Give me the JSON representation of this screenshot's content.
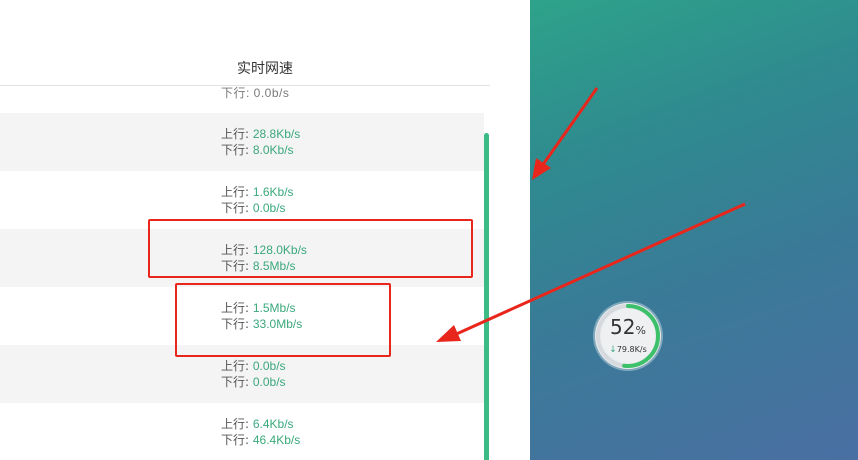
{
  "panel": {
    "column_header": "实时网速",
    "partial_row": {
      "down_value": "0.0b/s"
    },
    "rows": [
      {
        "up_label": "上行: ",
        "up_value": "28.8Kb/s",
        "down_label": "下行: ",
        "down_value": "8.0Kb/s"
      },
      {
        "up_label": "上行: ",
        "up_value": "1.6Kb/s",
        "down_label": "下行: ",
        "down_value": "0.0b/s"
      },
      {
        "up_label": "上行: ",
        "up_value": "128.0Kb/s",
        "down_label": "下行: ",
        "down_value": "8.5Mb/s"
      },
      {
        "up_label": "上行: ",
        "up_value": "1.5Mb/s",
        "down_label": "下行: ",
        "down_value": "33.0Mb/s"
      },
      {
        "up_label": "上行: ",
        "up_value": "0.0b/s",
        "down_label": "下行: ",
        "down_value": "0.0b/s"
      },
      {
        "up_label": "上行: ",
        "up_value": "6.4Kb/s",
        "down_label": "下行: ",
        "down_value": "46.4Kb/s"
      }
    ]
  },
  "widget": {
    "percent": "52",
    "percent_sign": "%",
    "percent_fraction": 0.52,
    "down_arrow": "↓",
    "down_speed": "79.8K/s"
  },
  "colors": {
    "speed_value": "#3aa87c",
    "scrollbar": "#3dbb85",
    "highlight": "#e8261c",
    "desktop_start": "#2ea38a",
    "desktop_end": "#4a6fa2"
  },
  "icons": {
    "arrow_annotations": "red-arrow-icon",
    "widget_down": "down-arrow-icon"
  }
}
